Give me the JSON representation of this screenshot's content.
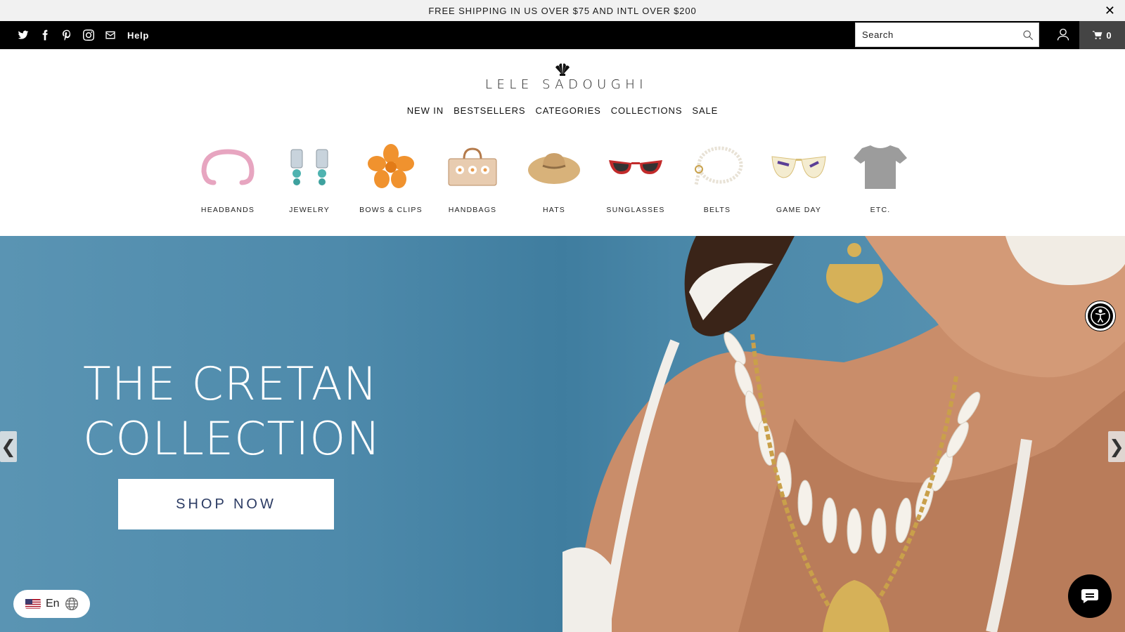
{
  "announcement": {
    "text": "FREE SHIPPING IN US OVER $75 AND INTL OVER $200",
    "close_icon": "close-icon"
  },
  "topbar": {
    "social_icons": [
      "twitter-icon",
      "facebook-icon",
      "pinterest-icon",
      "instagram-icon",
      "mail-icon"
    ],
    "help_label": "Help",
    "search_placeholder": "Search",
    "cart_count": "0",
    "bar_color": "#000000",
    "cart_bg": "#444444"
  },
  "header": {
    "logo_text": "LELE SADOUGHI",
    "logo_icon": "shell-logo-icon"
  },
  "main_nav": {
    "items": [
      "NEW IN",
      "BESTSELLERS",
      "CATEGORIES",
      "COLLECTIONS",
      "SALE"
    ]
  },
  "categories": [
    {
      "label": "HEADBANDS"
    },
    {
      "label": "JEWELRY"
    },
    {
      "label": "BOWS & CLIPS"
    },
    {
      "label": "HANDBAGS"
    },
    {
      "label": "HATS"
    },
    {
      "label": "SUNGLASSES"
    },
    {
      "label": "BELTS"
    },
    {
      "label": "GAME DAY"
    },
    {
      "label": "ETC."
    }
  ],
  "hero": {
    "title_line1": "THE CRETAN",
    "title_line2": "COLLECTION",
    "cta_label": "SHOP NOW",
    "prev_arrow": "❮",
    "next_arrow": "❯",
    "button_text_color": "#2b3b63"
  },
  "widgets": {
    "language_label": "En",
    "accessibility_icon": "accessibility-icon",
    "chat_icon": "chat-icon"
  }
}
